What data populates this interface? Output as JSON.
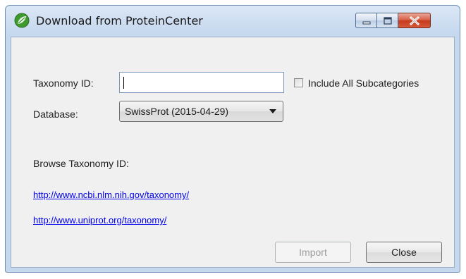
{
  "window": {
    "title": "Download from ProteinCenter",
    "app_icon": "proteincenter-leaf-icon",
    "caption_buttons": [
      "minimize-icon",
      "maximize-icon",
      "close-icon"
    ]
  },
  "form": {
    "taxonomy_label": "Taxonomy ID:",
    "taxonomy_value": "",
    "include_checkbox": {
      "label": "Include All Subcategories",
      "checked": false
    },
    "database_label": "Database:",
    "database_selected": "SwissProt (2015-04-29)",
    "browse_label": "Browse Taxonomy ID:",
    "links": [
      "http://www.ncbi.nlm.nih.gov/taxonomy/",
      "http://www.uniprot.org/taxonomy/"
    ]
  },
  "buttons": {
    "import_label": "Import",
    "import_enabled": false,
    "close_label": "Close"
  },
  "colors": {
    "link": "#0000ee",
    "close_button": "#c4391c",
    "disabled_text": "#9d9d9d"
  }
}
